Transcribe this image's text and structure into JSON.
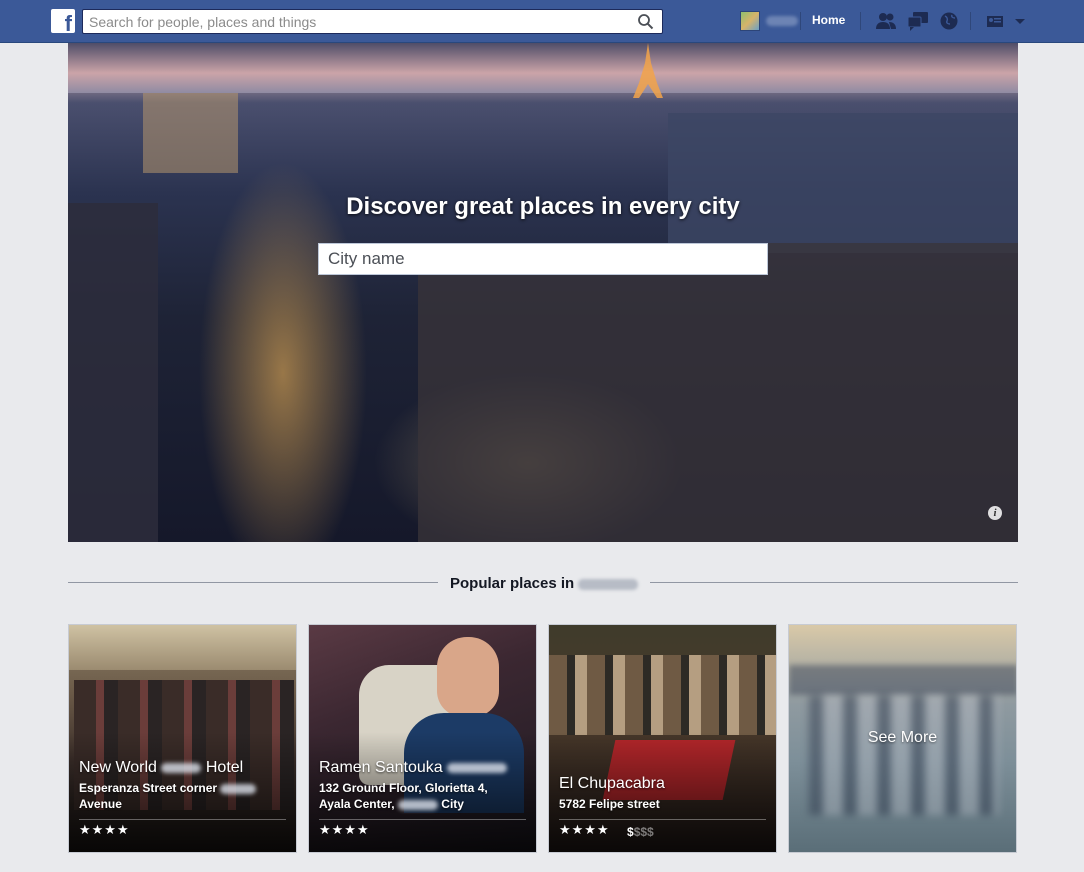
{
  "header": {
    "logo": "f",
    "search_placeholder": "Search for people, places and things",
    "home_label": "Home",
    "icons": [
      "friend-requests-icon",
      "messages-icon",
      "notifications-globe-icon",
      "privacy-shortcuts-icon",
      "account-menu-chevron-icon"
    ]
  },
  "hero": {
    "title": "Discover great places in every city",
    "city_placeholder": "City name",
    "info_icon": "i"
  },
  "popular": {
    "heading": "Popular places in"
  },
  "cards": [
    {
      "name_start": "New World",
      "name_end": "Hotel",
      "address_line1": "Esperanza Street corner",
      "address_line2": "Avenue",
      "stars": "★★★★",
      "price_on": "",
      "price_off": ""
    },
    {
      "name_start": "Ramen Santouka",
      "name_end": "",
      "address_line1": "132 Ground Floor, Glorietta 4,",
      "address_line2_start": "Ayala Center,",
      "address_line2_end": "City",
      "stars": "★★★★",
      "price_on": "",
      "price_off": ""
    },
    {
      "name_start": "El Chupacabra",
      "name_end": "",
      "address_line1": "5782 Felipe street",
      "address_line2": "",
      "stars": "★★★★",
      "price_on": "$",
      "price_off": "$$$"
    }
  ],
  "see_more": "See More",
  "colors": {
    "topbar": "#3b5998",
    "page_bg": "#e9eaed"
  }
}
